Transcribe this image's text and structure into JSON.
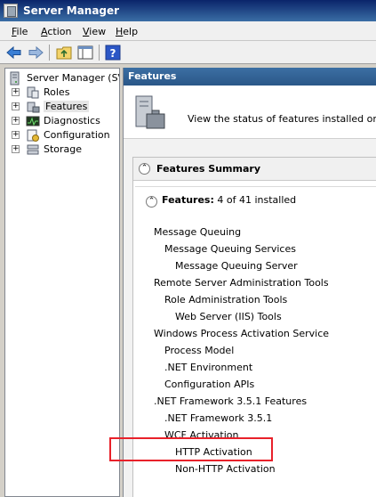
{
  "window": {
    "title": "Server Manager"
  },
  "menu": [
    {
      "first": "F",
      "rest": "ile"
    },
    {
      "first": "A",
      "rest": "ction"
    },
    {
      "first": "V",
      "rest": "iew"
    },
    {
      "first": "H",
      "rest": "elp"
    }
  ],
  "tree": {
    "root": "Server Manager (SVR",
    "items": [
      "Roles",
      "Features",
      "Diagnostics",
      "Configuration",
      "Storage"
    ],
    "selected": "Features"
  },
  "right": {
    "header": "Features",
    "description": "View the status of features installed on this s",
    "summary_title": "Features Summary",
    "features_label": "Features:",
    "features_count": "4 of 41 installed",
    "features": [
      "Message Queuing",
      "Message Queuing Services",
      "Message Queuing Server",
      "Remote Server Administration Tools",
      "Role Administration Tools",
      "Web Server (IIS) Tools",
      "Windows Process Activation Service",
      "Process Model",
      ".NET Environment",
      "Configuration APIs",
      ".NET Framework 3.5.1 Features",
      ".NET Framework 3.5.1",
      "WCF Activation",
      "HTTP Activation",
      "Non-HTTP Activation"
    ]
  },
  "colors": {
    "header_blue": "#2f5f93",
    "highlight_red": "#e8212a"
  }
}
